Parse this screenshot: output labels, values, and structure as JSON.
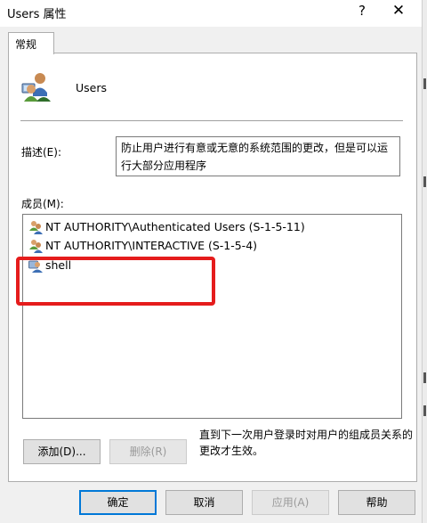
{
  "window": {
    "title": "Users 属性",
    "help_glyph": "?",
    "close_glyph": "✕"
  },
  "tabs": [
    {
      "label": "常规"
    }
  ],
  "group": {
    "name": "Users"
  },
  "description": {
    "label": "描述(E):",
    "line1": "防止用户进行有意或无意的系统范围的更改，但是可以运",
    "line2": "行大部分应用程序"
  },
  "members": {
    "label": "成员(M):",
    "items": [
      {
        "name": "NT AUTHORITY\\Authenticated Users (S-1-5-11)",
        "icon": "group-icon"
      },
      {
        "name": "NT AUTHORITY\\INTERACTIVE (S-1-5-4)",
        "icon": "group-icon"
      },
      {
        "name": "shell",
        "icon": "user-icon"
      }
    ]
  },
  "actions": {
    "add": "添加(D)...",
    "remove": "删除(R)",
    "note": "直到下一次用户登录时对用户的组成员关系的更改才生效。"
  },
  "footer": {
    "ok": "确定",
    "cancel": "取消",
    "apply": "应用(A)",
    "help": "帮助"
  },
  "colors": {
    "highlight": "#e51c1c",
    "default_button_border": "#0078d7"
  }
}
